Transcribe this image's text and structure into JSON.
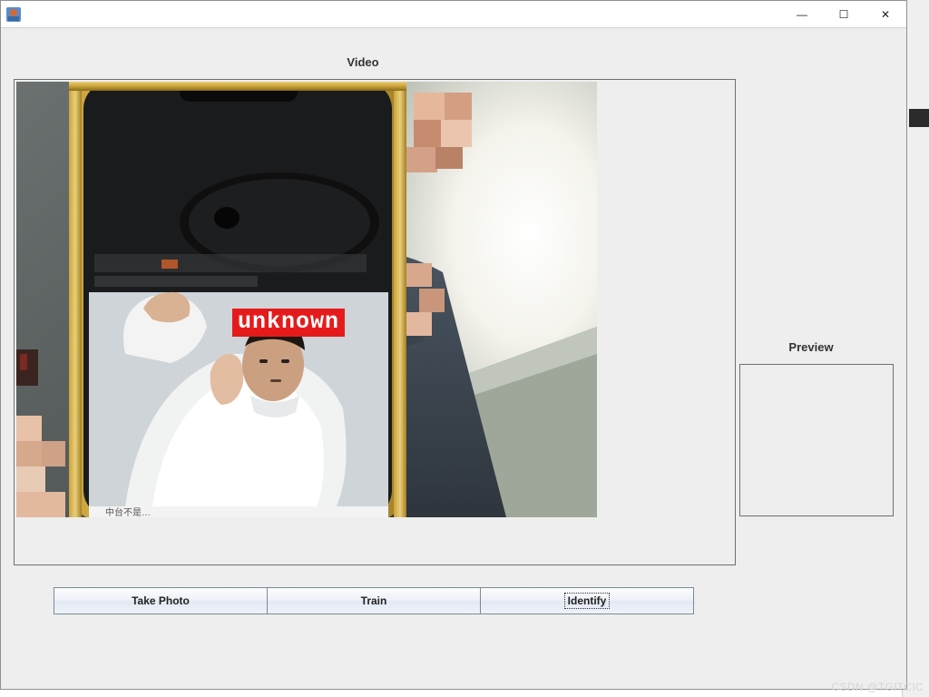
{
  "window": {
    "title": "",
    "controls": {
      "minimize_glyph": "—",
      "maximize_glyph": "☐",
      "close_glyph": "✕"
    }
  },
  "labels": {
    "video": "Video",
    "preview": "Preview"
  },
  "video": {
    "overlay_tag": "unknown",
    "overlay_color": "#e51b1b"
  },
  "buttons": {
    "take_photo": "Take Photo",
    "train": "Train",
    "identify": "Identify"
  },
  "watermark": "CSDN @TGITCIC"
}
